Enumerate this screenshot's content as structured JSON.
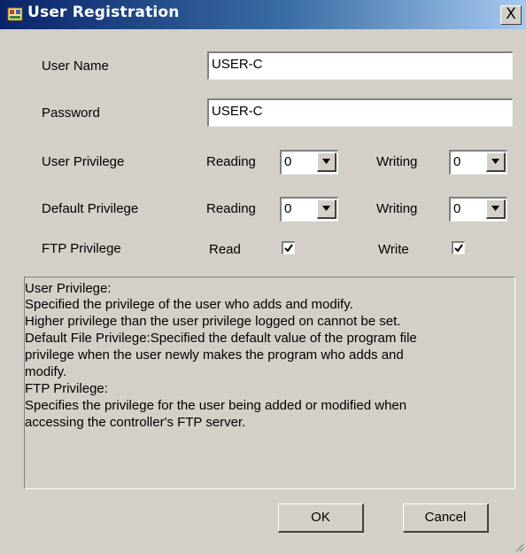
{
  "window": {
    "title": "User Registration",
    "close_label": "X"
  },
  "form": {
    "user_name": {
      "label": "User Name",
      "value": "USER-C"
    },
    "password": {
      "label": "Password",
      "value": "USER-C"
    },
    "user_privilege": {
      "label": "User Privilege",
      "reading_label": "Reading",
      "reading_value": "0",
      "writing_label": "Writing",
      "writing_value": "0"
    },
    "default_privilege": {
      "label": "Default Privilege",
      "reading_label": "Reading",
      "reading_value": "0",
      "writing_label": "Writing",
      "writing_value": "0"
    },
    "ftp_privilege": {
      "label": "FTP Privilege",
      "read_label": "Read",
      "read_checked": true,
      "write_label": "Write",
      "write_checked": true
    }
  },
  "info_lines": [
    "User Privilege:",
    "Specified the privilege of the user who adds and modify.",
    "Higher privilege than the user privilege logged on cannot be set.",
    "Default File Privilege:Specified the default value of the program file",
    "privilege when the user newly makes the program who adds and",
    "modify.",
    "FTP Privilege:",
    "Specifies the privilege for the user being added or modified when",
    "accessing the controller's FTP server."
  ],
  "buttons": {
    "ok": "OK",
    "cancel": "Cancel"
  },
  "colors": {
    "titlebar_start": "#0a246a",
    "titlebar_end": "#a6caf0",
    "dialog_bg": "#d4d0c8"
  }
}
